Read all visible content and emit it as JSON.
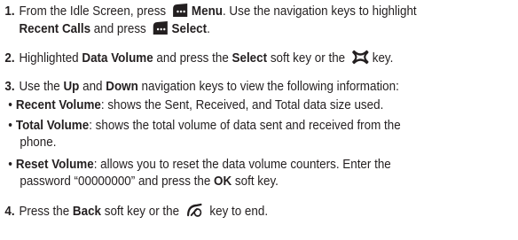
{
  "steps": [
    {
      "number": "1.",
      "line1_before": "From the Idle Screen, press",
      "line1_icon": "softkey-menu-icon",
      "line1_bold": "Menu",
      "line1_after": ". Use the navigation keys to highlight",
      "line2_bold": "Recent Calls",
      "line2_mid": " and press",
      "line2_icon": "softkey-select-icon",
      "line2_bold2": "Select",
      "line2_after": "."
    },
    {
      "number": "2.",
      "before": "Highlighted ",
      "bold1": "Data Volume",
      "mid": " and press the ",
      "bold2": "Select",
      "after1": " soft key or the",
      "icon": "navigation-ok-key-icon",
      "after2": "key."
    },
    {
      "number": "3.",
      "t1": "Use the ",
      "bold1": "Up",
      "t2": " and ",
      "bold2": "Down",
      "t3": " navigation keys to view the following information:"
    },
    {
      "number": "4.",
      "t1": "Press the ",
      "bold1": "Back",
      "t2": " soft key or the",
      "icon": "end-key-icon",
      "t3": " key to end."
    }
  ],
  "bullets": [
    {
      "marker": "•",
      "term": "Recent Volume",
      "text": ": shows the Sent, Received, and Total data size used."
    },
    {
      "marker": "•",
      "term": "Total Volume",
      "text": ": shows the total volume of data sent and received from the",
      "text2": "phone."
    },
    {
      "marker": "•",
      "term": "Reset Volume",
      "text": ": allows you to reset the data volume counters. Enter the",
      "text2a": "password “00000000” and press the ",
      "text2_bold": "OK",
      "text2b": " soft key."
    }
  ]
}
